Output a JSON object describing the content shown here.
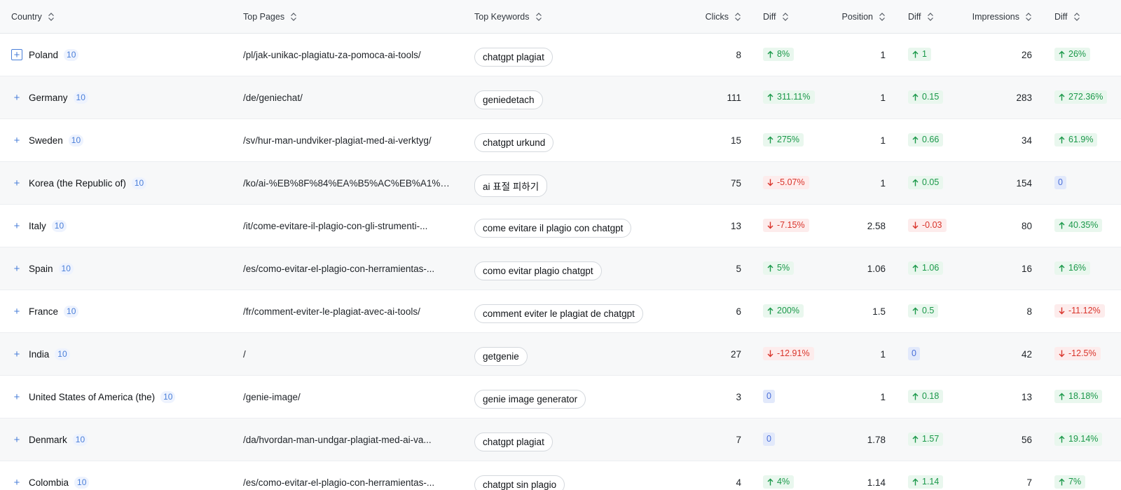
{
  "header": {
    "country": "Country",
    "top_pages": "Top Pages",
    "top_keywords": "Top Keywords",
    "clicks": "Clicks",
    "diff1": "Diff",
    "position": "Position",
    "diff2": "Diff",
    "impressions": "Impressions",
    "diff3": "Diff"
  },
  "colors": {
    "up": "#1a9849",
    "down": "#d9342b",
    "zero": "#4a6fd9",
    "accent": "#4a7fd9"
  },
  "rows": [
    {
      "country": "Poland",
      "count": "10",
      "page": "/pl/jak-unikac-plagiatu-za-pomoca-ai-tools/",
      "keyword": "chatgpt plagiat",
      "clicks": "8",
      "clicks_diff": "8%",
      "clicks_dir": "up",
      "position": "1",
      "position_diff": "1",
      "position_dir": "up",
      "impressions": "26",
      "impr_diff": "26%",
      "impr_dir": "up"
    },
    {
      "country": "Germany",
      "count": "10",
      "page": "/de/geniechat/",
      "keyword": "geniedetach",
      "clicks": "111",
      "clicks_diff": "311.11%",
      "clicks_dir": "up",
      "position": "1",
      "position_diff": "0.15",
      "position_dir": "up",
      "impressions": "283",
      "impr_diff": "272.36%",
      "impr_dir": "up"
    },
    {
      "country": "Sweden",
      "count": "10",
      "page": "/sv/hur-man-undviker-plagiat-med-ai-verktyg/",
      "keyword": "chatgpt urkund",
      "clicks": "15",
      "clicks_diff": "275%",
      "clicks_dir": "up",
      "position": "1",
      "position_diff": "0.66",
      "position_dir": "up",
      "impressions": "34",
      "impr_diff": "61.9%",
      "impr_dir": "up"
    },
    {
      "country": "Korea (the Republic of)",
      "count": "10",
      "page": "/ko/ai-%EB%8F%84%EA%B5%AC%EB%A1%9...",
      "keyword": "ai 표절 피하기",
      "clicks": "75",
      "clicks_diff": "-5.07%",
      "clicks_dir": "down",
      "position": "1",
      "position_diff": "0.05",
      "position_dir": "up",
      "impressions": "154",
      "impr_diff": "0",
      "impr_dir": "zero"
    },
    {
      "country": "Italy",
      "count": "10",
      "page": "/it/come-evitare-il-plagio-con-gli-strumenti-...",
      "keyword": "come evitare il plagio con chatgpt",
      "clicks": "13",
      "clicks_diff": "-7.15%",
      "clicks_dir": "down",
      "position": "2.58",
      "position_diff": "-0.03",
      "position_dir": "down",
      "impressions": "80",
      "impr_diff": "40.35%",
      "impr_dir": "up"
    },
    {
      "country": "Spain",
      "count": "10",
      "page": "/es/como-evitar-el-plagio-con-herramientas-...",
      "keyword": "como evitar plagio chatgpt",
      "clicks": "5",
      "clicks_diff": "5%",
      "clicks_dir": "up",
      "position": "1.06",
      "position_diff": "1.06",
      "position_dir": "up",
      "impressions": "16",
      "impr_diff": "16%",
      "impr_dir": "up"
    },
    {
      "country": "France",
      "count": "10",
      "page": "/fr/comment-eviter-le-plagiat-avec-ai-tools/",
      "keyword": "comment eviter le plagiat de chatgpt",
      "clicks": "6",
      "clicks_diff": "200%",
      "clicks_dir": "up",
      "position": "1.5",
      "position_diff": "0.5",
      "position_dir": "up",
      "impressions": "8",
      "impr_diff": "-11.12%",
      "impr_dir": "down"
    },
    {
      "country": "India",
      "count": "10",
      "page": "/",
      "keyword": "getgenie",
      "clicks": "27",
      "clicks_diff": "-12.91%",
      "clicks_dir": "down",
      "position": "1",
      "position_diff": "0",
      "position_dir": "zero",
      "impressions": "42",
      "impr_diff": "-12.5%",
      "impr_dir": "down"
    },
    {
      "country": "United States of America (the)",
      "count": "10",
      "page": "/genie-image/",
      "keyword": "genie image generator",
      "clicks": "3",
      "clicks_diff": "0",
      "clicks_dir": "zero",
      "position": "1",
      "position_diff": "0.18",
      "position_dir": "up",
      "impressions": "13",
      "impr_diff": "18.18%",
      "impr_dir": "up"
    },
    {
      "country": "Denmark",
      "count": "10",
      "page": "/da/hvordan-man-undgar-plagiat-med-ai-va...",
      "keyword": "chatgpt plagiat",
      "clicks": "7",
      "clicks_diff": "0",
      "clicks_dir": "zero",
      "position": "1.78",
      "position_diff": "1.57",
      "position_dir": "up",
      "impressions": "56",
      "impr_diff": "19.14%",
      "impr_dir": "up"
    },
    {
      "country": "Colombia",
      "count": "10",
      "page": "/es/como-evitar-el-plagio-con-herramientas-...",
      "keyword": "chatgpt sin plagio",
      "clicks": "4",
      "clicks_diff": "4%",
      "clicks_dir": "up",
      "position": "1.14",
      "position_diff": "1.14",
      "position_dir": "up",
      "impressions": "7",
      "impr_diff": "7%",
      "impr_dir": "up"
    }
  ]
}
